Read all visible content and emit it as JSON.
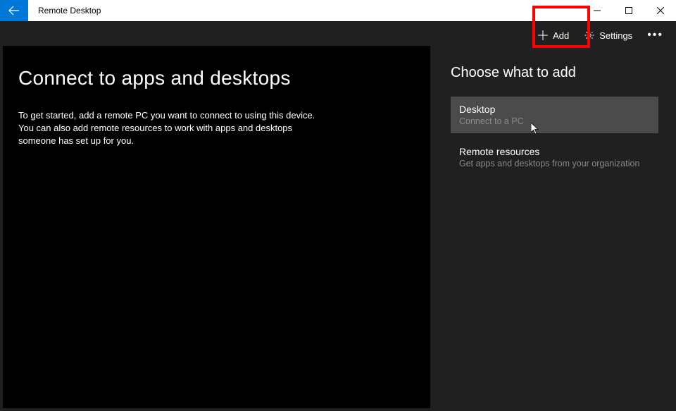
{
  "window": {
    "title": "Remote Desktop"
  },
  "commandBar": {
    "add": "Add",
    "settings": "Settings"
  },
  "main": {
    "heading": "Connect to apps and desktops",
    "description": "To get started, add a remote PC you want to connect to using this device. You can also add remote resources to work with apps and desktops someone has set up for you."
  },
  "sidePanel": {
    "heading": "Choose what to add",
    "options": [
      {
        "title": "Desktop",
        "subtitle": "Connect to a PC"
      },
      {
        "title": "Remote resources",
        "subtitle": "Get apps and desktops from your organization"
      }
    ]
  }
}
